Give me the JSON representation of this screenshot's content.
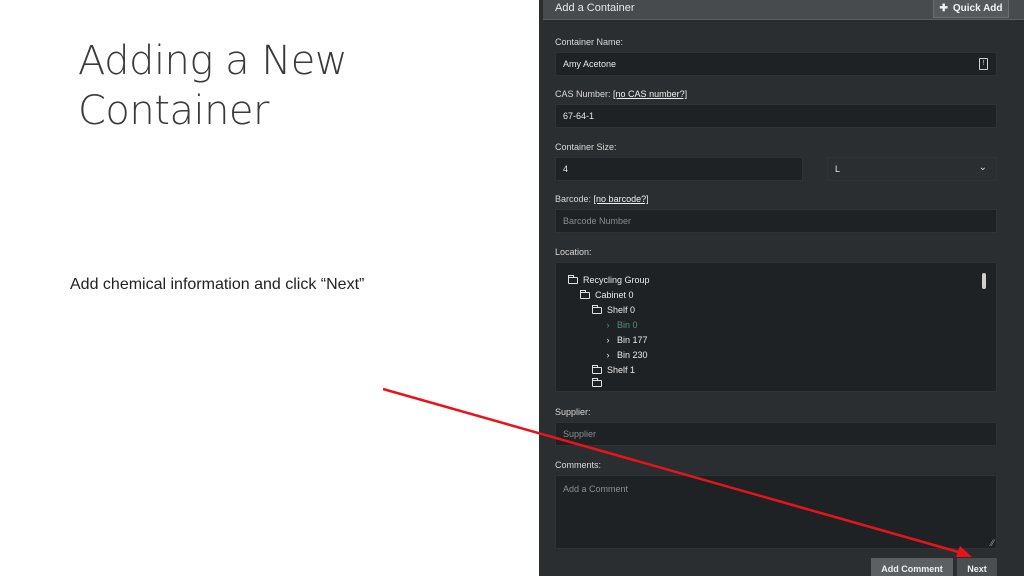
{
  "slide": {
    "title_line1": "Adding a New",
    "title_line2": "Container",
    "caption": "Add chemical information and click “Next”"
  },
  "panel": {
    "title": "Add a Container",
    "quick_add_label": "Quick Add",
    "container_name": {
      "label": "Container Name:",
      "value": "Amy Acetone"
    },
    "cas_number": {
      "label": "CAS Number:",
      "link": "[no CAS number?]",
      "value": "67-64-1"
    },
    "container_size": {
      "label": "Container Size:",
      "value": "4",
      "unit": "L"
    },
    "barcode": {
      "label": "Barcode:",
      "link": "[no barcode?]",
      "placeholder": "Barcode Number"
    },
    "location": {
      "label": "Location:",
      "tree": [
        {
          "label": "Recycling Group",
          "type": "folder"
        },
        {
          "label": "Cabinet 0",
          "type": "folder"
        },
        {
          "label": "Shelf 0",
          "type": "folder"
        },
        {
          "label": "Bin 0",
          "type": "bin"
        },
        {
          "label": "Bin 177",
          "type": "bin"
        },
        {
          "label": "Bin 230",
          "type": "bin"
        },
        {
          "label": "Shelf 1",
          "type": "folder"
        }
      ]
    },
    "supplier": {
      "label": "Supplier:",
      "placeholder": "Supplier"
    },
    "comments": {
      "label": "Comments:",
      "placeholder": "Add a Comment"
    },
    "buttons": {
      "add_comment": "Add Comment",
      "next": "Next"
    }
  },
  "colors": {
    "arrow": "#e8141b",
    "panel_bg": "#2b2e30",
    "field_bg": "#1f2224"
  }
}
